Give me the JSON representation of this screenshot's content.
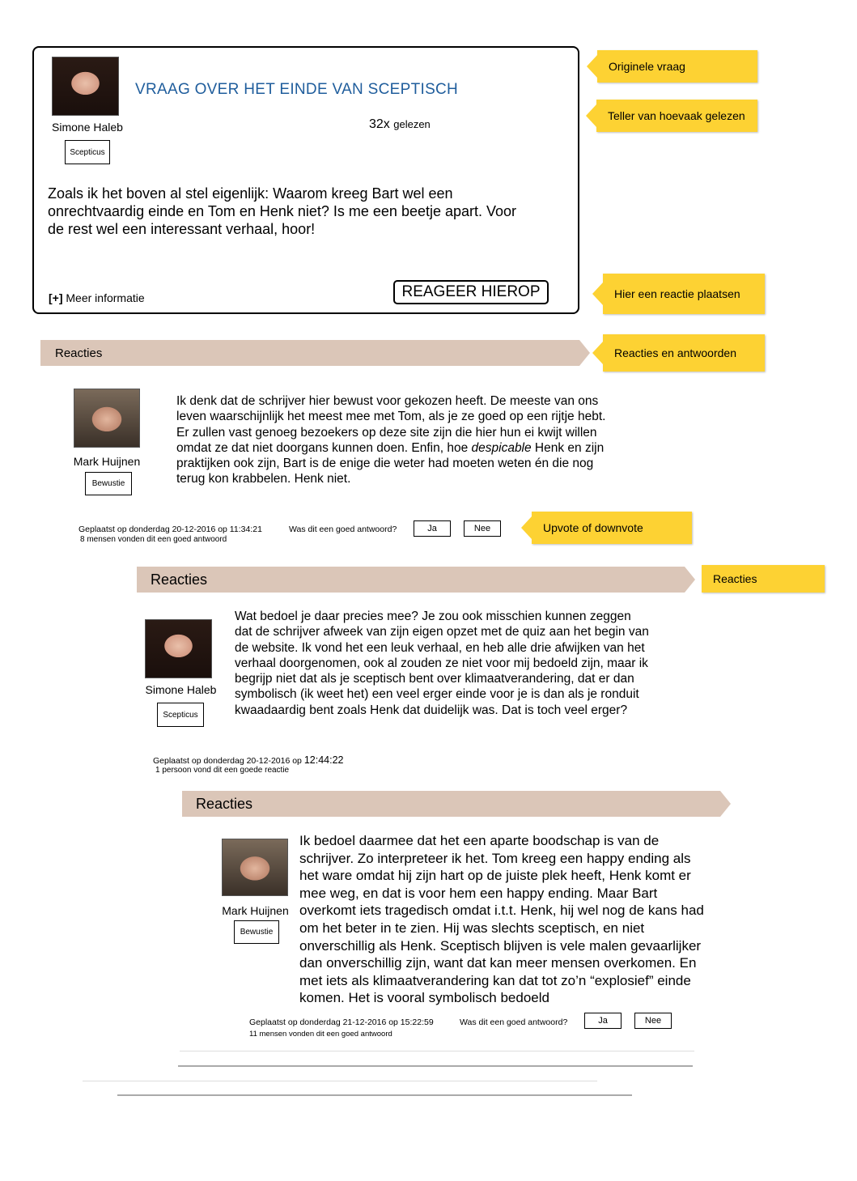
{
  "question": {
    "title": "VRAAG OVER HET EINDE VAN SCEPTISCH",
    "author": "Simone Haleb",
    "badge": "Scepticus",
    "read_count": "32x",
    "read_label": "gelezen",
    "body": "Zoals ik het boven al stel eigenlijk: Waarom kreeg Bart wel een onrechtvaardig einde en Tom en Henk niet? Is me een beetje apart. Voor de rest wel een interessant verhaal, hoor!",
    "more_icon": "[+]",
    "more_label": "Meer informatie",
    "reply_button": "REAGEER HIEROP"
  },
  "callouts": {
    "original_question": "Originele vraag",
    "read_counter": "Teller van hoevaak gelezen",
    "post_reply": "Hier een reactie plaatsen",
    "replies_answers": "Reacties en antwoorden",
    "vote": "Upvote of downvote",
    "replies": "Reacties"
  },
  "reply_sections": [
    {
      "label": "Reacties"
    },
    {
      "label": "Reacties"
    },
    {
      "label": "Reacties"
    }
  ],
  "replies": [
    {
      "author": "Mark Huijnen",
      "badge": "Bewustie",
      "text_before_italic": "Ik denk dat de schrijver hier bewust voor gekozen heeft. De meeste van ons leven waarschijnlijk het meest mee met Tom, als je ze goed op een rijtje hebt. Er zullen vast genoeg bezoekers op deze site zijn die hier hun ei kwijt willen omdat ze dat niet doorgans kunnen doen. Enfin, hoe ",
      "italic": "despicable",
      "text_after_italic": " Henk en zijn praktijken ook zijn, Bart is de enige die weter had moeten weten én die nog terug kon krabbelen. Henk niet.",
      "posted": "Geplaatst op donderdag 20-12-2016 op 11:34:21",
      "vote_question_prefix": "Was dit een goed ",
      "vote_question_bold": "antwoord",
      "vote_question_suffix": "?",
      "yes": "Ja",
      "no": "Nee",
      "votes": "8 mensen vonden dit een goed antwoord"
    },
    {
      "author": "Simone Haleb",
      "badge": "Scepticus",
      "text": "Wat bedoel je daar precies mee? Je zou ook misschien kunnen zeggen dat de schrijver afweek van zijn eigen opzet met de quiz aan het begin van de website. Ik vond het een leuk verhaal, en heb alle drie afwijken van het verhaal doorgenomen, ook al zouden ze niet voor mij bedoeld zijn, maar ik begrijp niet dat als je sceptisch bent over klimaatverandering, dat er dan symbolisch (ik weet het) een veel erger einde voor je is dan als je ronduit kwaadaardig bent zoals Henk dat duidelijk was. Dat is toch veel erger?",
      "posted": "Geplaatst op donderdag 20-12-2016 op",
      "posted_time": "12:44:22",
      "votes": "1 persoon vond dit een goede reactie"
    },
    {
      "author": "Mark Huijnen",
      "badge": "Bewustie",
      "text": "Ik bedoel daarmee dat het een aparte boodschap is van de schrijver. Zo interpreteer ik het. Tom kreeg een happy ending als het ware omdat hij zijn hart op de juiste plek heeft, Henk komt er mee weg, en dat is voor hem een happy ending. Maar Bart overkomt iets tragedisch omdat i.t.t. Henk, hij wel nog de kans had om het beter in te zien. Hij was slechts sceptisch, en niet onverschillig als Henk. Sceptisch blijven is vele malen gevaarlijker dan onverschillig zijn, want dat kan meer mensen overkomen. En met iets als klimaatverandering kan dat tot zo’n “explosief” einde komen. Het is vooral symbolisch bedoeld",
      "posted": "Geplaatst op donderdag 21-12-2016 op 15:22:59",
      "vote_question_prefix": "Was dit een goed ",
      "vote_question_bold": "antwoord",
      "vote_question_suffix": "?",
      "yes": "Ja",
      "no": "Nee",
      "votes": "11 mensen vonden dit een goed antwoord"
    }
  ],
  "colors": {
    "callout": "#fdd233",
    "bar": "#dbc6b8",
    "title": "#1f5d9c"
  }
}
